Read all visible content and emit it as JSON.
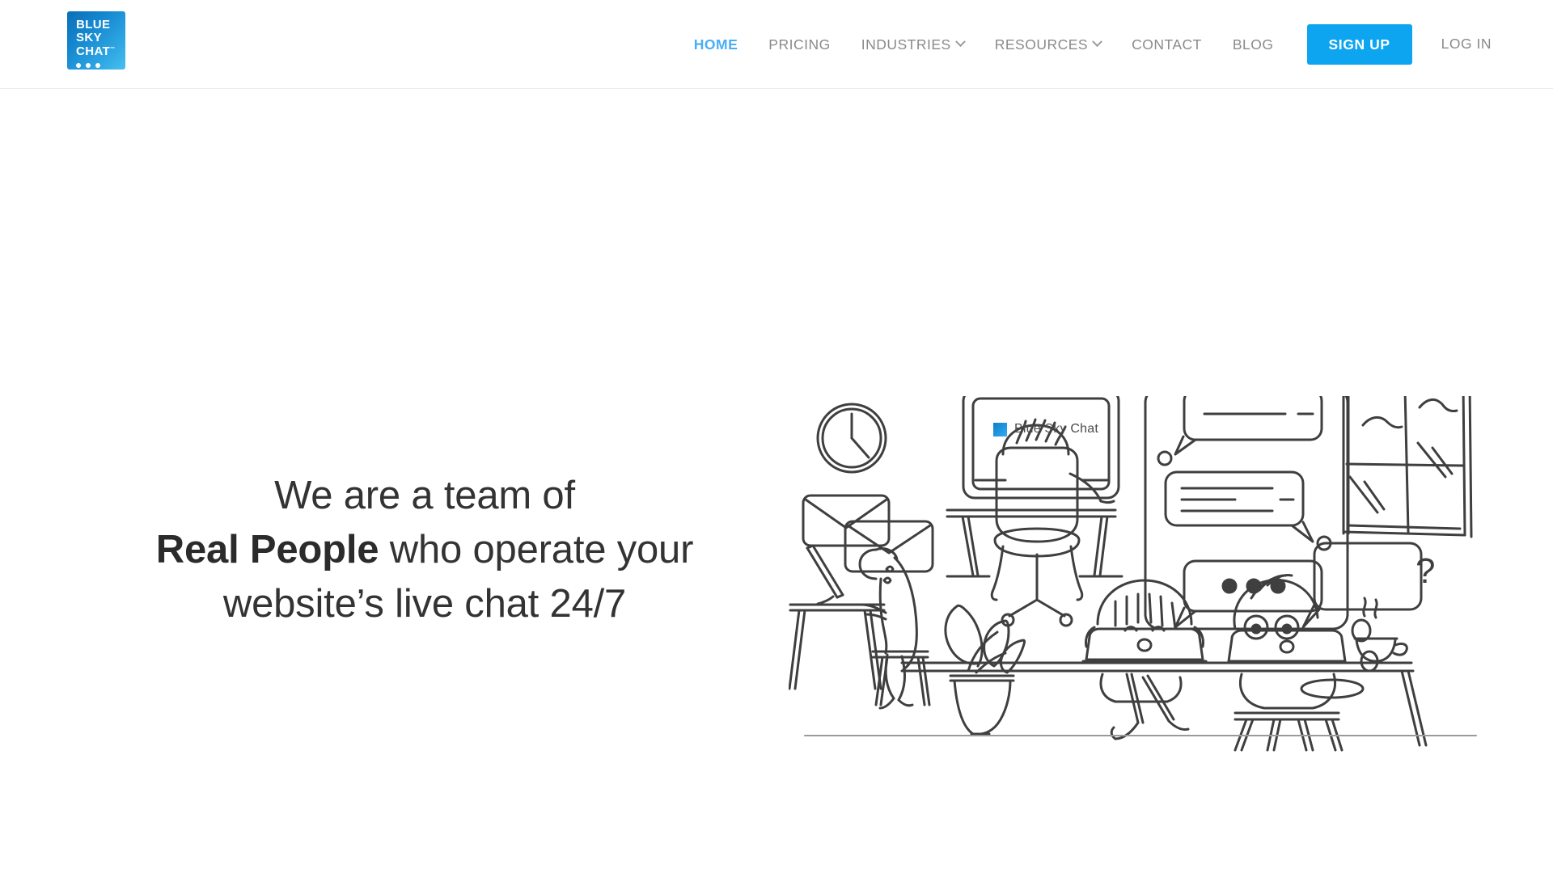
{
  "brand": {
    "logo_line1": "BLUE",
    "logo_line2": "SKY",
    "logo_line3": "CHAT",
    "logo_tm": "™",
    "accent_color": "#0ea5f0",
    "active_link_color": "#4aaef4"
  },
  "nav": {
    "items": [
      {
        "label": "HOME",
        "active": true,
        "has_dropdown": false
      },
      {
        "label": "PRICING",
        "active": false,
        "has_dropdown": false
      },
      {
        "label": "INDUSTRIES",
        "active": false,
        "has_dropdown": true
      },
      {
        "label": "RESOURCES",
        "active": false,
        "has_dropdown": true
      },
      {
        "label": "CONTACT",
        "active": false,
        "has_dropdown": false
      },
      {
        "label": "BLOG",
        "active": false,
        "has_dropdown": false
      }
    ],
    "signup_label": "SIGN UP",
    "login_label": "LOG IN"
  },
  "hero": {
    "headline_line1": "We are a team of",
    "headline_bold": "Real People",
    "headline_rest": " who operate your",
    "headline_line3": "website’s live chat 24/7"
  },
  "illustration": {
    "screen_label": "Blue Sky Chat",
    "question_mark": "?",
    "stroke_color": "#3f3f3f",
    "elements": [
      "wall-clock",
      "envelopes",
      "desktop-monitor",
      "office-chair",
      "person-at-desk",
      "potted-plant",
      "chat-bubbles-panel",
      "window",
      "person-laptop-left",
      "person-laptop-right",
      "question-speech-bubble",
      "coffee-cup"
    ]
  }
}
